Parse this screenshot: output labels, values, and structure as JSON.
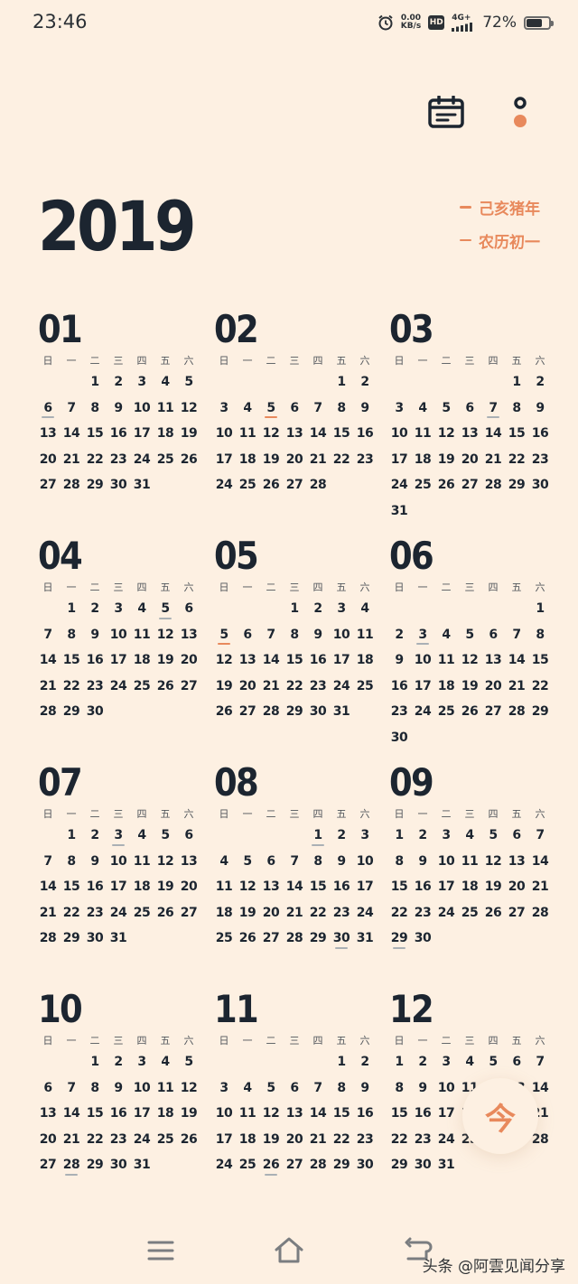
{
  "status_bar": {
    "time": "23:46",
    "net_speed_value": "0.00",
    "net_speed_unit": "KB/s",
    "hd_label": "HD",
    "signal_label": "4G+",
    "battery_percent": "72%",
    "battery_level": 0.72
  },
  "header": {
    "year": "2019",
    "lunar_year": "己亥猪年",
    "lunar_day": "农历初一"
  },
  "weekday_labels": [
    "日",
    "一",
    "二",
    "三",
    "四",
    "五",
    "六"
  ],
  "months": [
    {
      "num": "01",
      "first_weekday": 2,
      "days": 31,
      "marked": [
        6
      ],
      "accent": []
    },
    {
      "num": "02",
      "first_weekday": 5,
      "days": 28,
      "marked": [
        5
      ],
      "accent": [
        5
      ]
    },
    {
      "num": "03",
      "first_weekday": 5,
      "days": 31,
      "marked": [
        7
      ],
      "accent": []
    },
    {
      "num": "04",
      "first_weekday": 1,
      "days": 30,
      "marked": [
        5
      ],
      "accent": []
    },
    {
      "num": "05",
      "first_weekday": 3,
      "days": 31,
      "marked": [
        5
      ],
      "accent": [
        5
      ]
    },
    {
      "num": "06",
      "first_weekday": 6,
      "days": 30,
      "marked": [
        3
      ],
      "accent": []
    },
    {
      "num": "07",
      "first_weekday": 1,
      "days": 31,
      "marked": [
        3
      ],
      "accent": []
    },
    {
      "num": "08",
      "first_weekday": 4,
      "days": 31,
      "marked": [
        1,
        30
      ],
      "accent": []
    },
    {
      "num": "09",
      "first_weekday": 0,
      "days": 30,
      "marked": [
        29
      ],
      "accent": []
    },
    {
      "num": "10",
      "first_weekday": 2,
      "days": 31,
      "marked": [
        28
      ],
      "accent": []
    },
    {
      "num": "11",
      "first_weekday": 5,
      "days": 30,
      "marked": [
        26
      ],
      "accent": []
    },
    {
      "num": "12",
      "first_weekday": 0,
      "days": 31,
      "marked": [],
      "accent": []
    }
  ],
  "today_button": {
    "label": "今"
  },
  "colors": {
    "background": "#fdf0e2",
    "accent": "#e8895c",
    "text": "#1c2530"
  },
  "watermark": "头条 @阿雲见闻分享"
}
